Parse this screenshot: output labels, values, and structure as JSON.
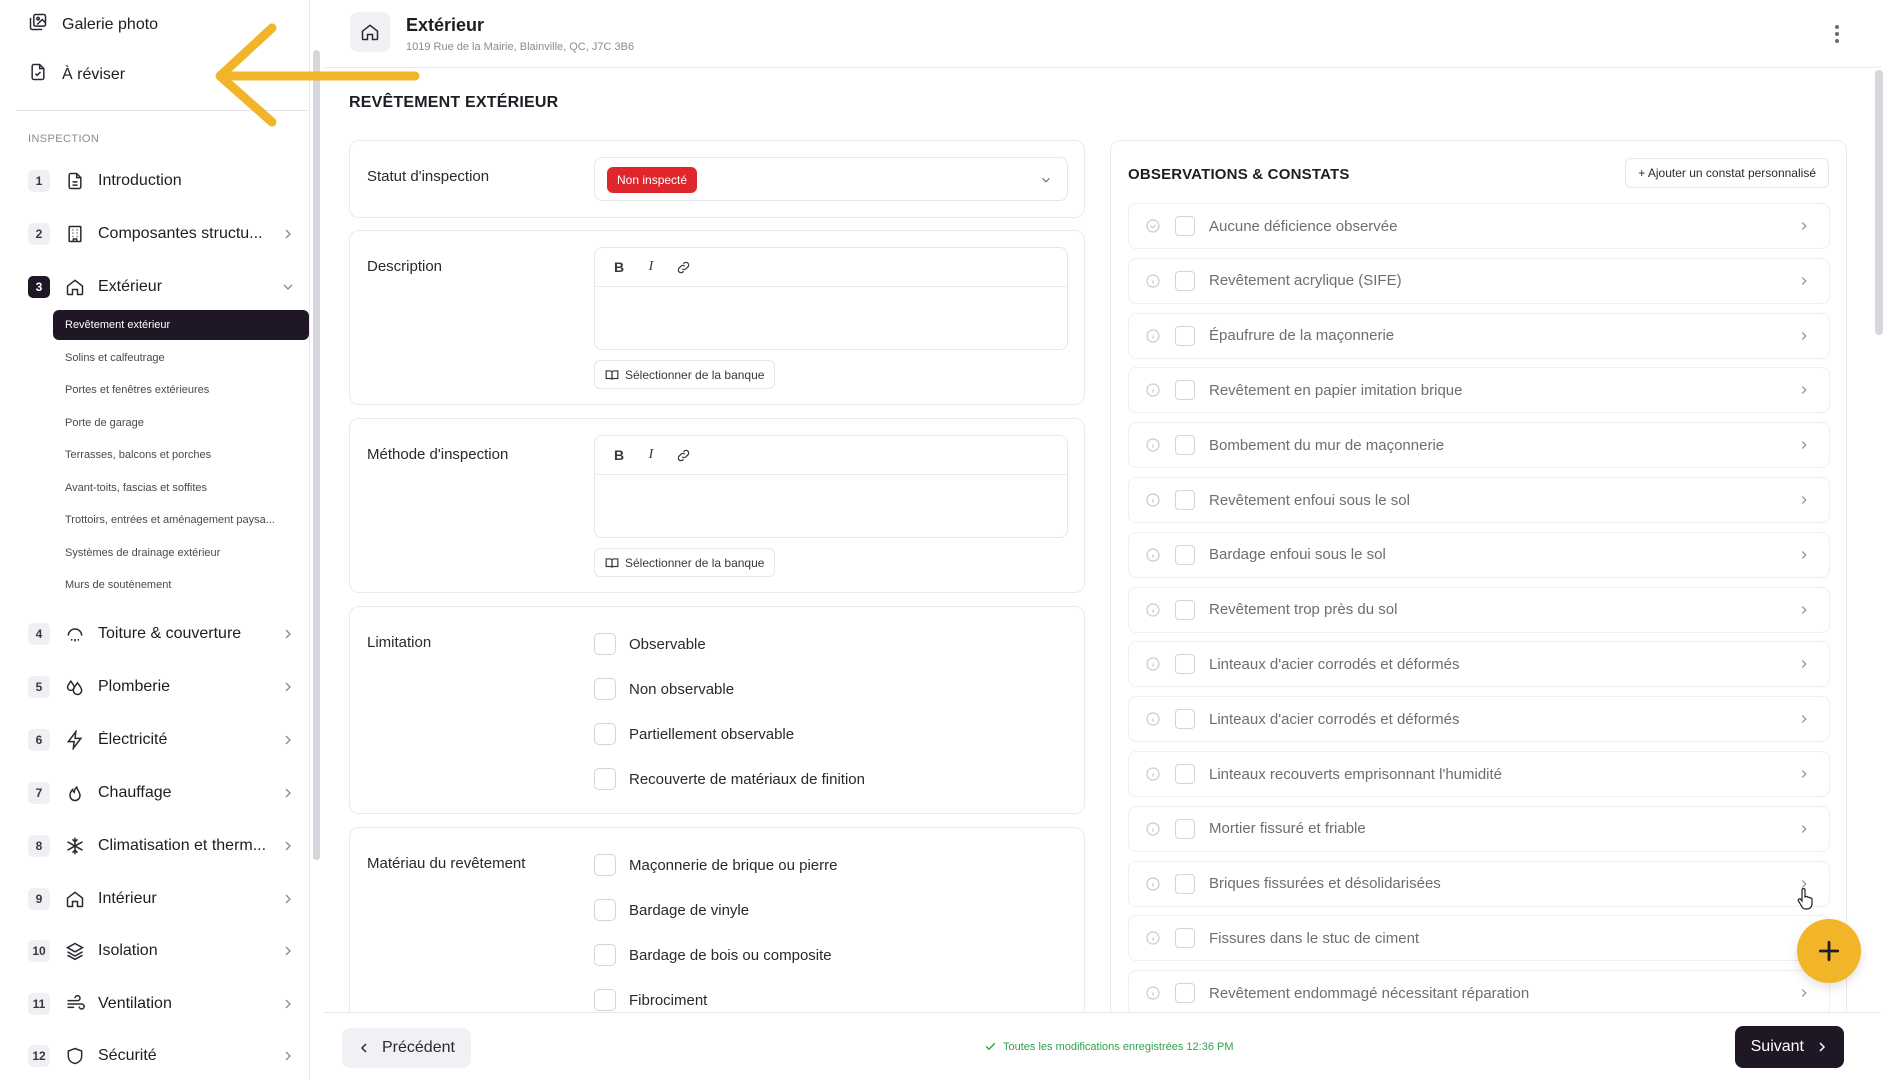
{
  "sidebar": {
    "top_links": [
      {
        "label": "Galerie photo",
        "icon": "photo-gallery-icon"
      },
      {
        "label": "À réviser",
        "icon": "review-icon"
      }
    ],
    "section_label": "INSPECTION",
    "items": [
      {
        "num": "1",
        "label": "Introduction",
        "icon": "document-icon"
      },
      {
        "num": "2",
        "label": "Composantes structu...",
        "icon": "building-icon"
      },
      {
        "num": "3",
        "label": "Extérieur",
        "icon": "home-icon"
      },
      {
        "num": "4",
        "label": "Toiture & couverture",
        "icon": "roof-icon"
      },
      {
        "num": "5",
        "label": "Plomberie",
        "icon": "droplets-icon"
      },
      {
        "num": "6",
        "label": "Électricité",
        "icon": "zap-icon"
      },
      {
        "num": "7",
        "label": "Chauffage",
        "icon": "flame-icon"
      },
      {
        "num": "8",
        "label": "Climatisation et therm...",
        "icon": "snowflake-icon"
      },
      {
        "num": "9",
        "label": "Intérieur",
        "icon": "home-icon"
      },
      {
        "num": "10",
        "label": "Isolation",
        "icon": "layers-icon"
      },
      {
        "num": "11",
        "label": "Ventilation",
        "icon": "wind-icon"
      },
      {
        "num": "12",
        "label": "Sécurité",
        "icon": "shield-icon"
      }
    ],
    "sub_items": [
      "Revêtement extérieur",
      "Solins et calfeutrage",
      "Portes et fenêtres extérieures",
      "Porte de garage",
      "Terrasses, balcons et porches",
      "Avant-toits, fascias et soffites",
      "Trottoirs, entrées et aménagement paysa...",
      "Systèmes de drainage extérieur",
      "Murs de soutènement"
    ]
  },
  "header": {
    "title": "Extérieur",
    "address": "1019 Rue de la Mairie, Blainville, QC, J7C 3B6"
  },
  "page_title": "REVÊTEMENT EXTÉRIEUR",
  "form": {
    "status_label": "Statut d'inspection",
    "status_value": "Non inspecté",
    "status_color": "#e0262d",
    "description_label": "Description",
    "method_label": "Méthode d'inspection",
    "bank_button": "Sélectionner de la banque",
    "toolbar": {
      "bold": "B",
      "italic": "I"
    },
    "limitation_label": "Limitation",
    "limitation_options": [
      "Observable",
      "Non observable",
      "Partiellement observable",
      "Recouverte de matériaux de finition"
    ],
    "material_label": "Matériau du revêtement",
    "material_options": [
      "Maçonnerie de brique ou pierre",
      "Bardage de vinyle",
      "Bardage de bois ou composite",
      "Fibrociment"
    ]
  },
  "observations": {
    "title": "OBSERVATIONS & CONSTATS",
    "add_button": "+ Ajouter un constat personnalisé",
    "items": [
      "Aucune déficience observée",
      "Revêtement acrylique (SIFE)",
      "Épaufrure de la maçonnerie",
      "Revêtement en papier imitation brique",
      "Bombement du mur de maçonnerie",
      "Revêtement enfoui sous le sol",
      "Bardage enfoui sous le sol",
      "Revêtement trop près du sol",
      "Linteaux d'acier corrodés et déformés",
      "Linteaux d'acier corrodés et déformés",
      "Linteaux recouverts emprisonnant l'humidité",
      "Mortier fissuré et friable",
      "Briques fissurées et désolidarisées",
      "Fissures dans le stuc de ciment",
      "Revêtement endommagé nécessitant réparation"
    ]
  },
  "footer": {
    "prev_label": "Précédent",
    "save_status": "Toutes les modifications enregistrées 12:36 PM",
    "next_label": "Suivant"
  },
  "colors": {
    "accent_dark": "#1f1726",
    "fab": "#f2b52a",
    "arrow": "#f2b52a",
    "success": "#2fa34a"
  }
}
